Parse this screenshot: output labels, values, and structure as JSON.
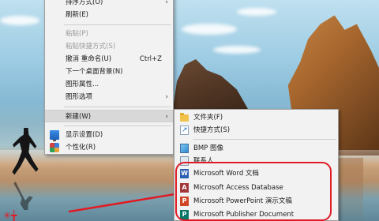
{
  "context_menu": {
    "items": [
      {
        "label": "排序方式(O)",
        "accel": "",
        "submenu": true,
        "disabled": false
      },
      {
        "label": "刷新(E)",
        "accel": "",
        "submenu": false,
        "disabled": false
      },
      {
        "label": "粘贴(P)",
        "accel": "",
        "submenu": false,
        "disabled": true
      },
      {
        "label": "粘贴快捷方式(S)",
        "accel": "",
        "submenu": false,
        "disabled": true
      },
      {
        "label": "撤消 重命名(U)",
        "accel": "Ctrl+Z",
        "submenu": false,
        "disabled": false
      },
      {
        "label": "下一个桌面背景(N)",
        "accel": "",
        "submenu": false,
        "disabled": false
      },
      {
        "label": "图形属性...",
        "accel": "",
        "submenu": false,
        "disabled": false
      },
      {
        "label": "图形选项",
        "accel": "",
        "submenu": true,
        "disabled": false
      },
      {
        "label": "新建(W)",
        "accel": "",
        "submenu": true,
        "disabled": false,
        "highlighted": true
      },
      {
        "label": "显示设置(D)",
        "accel": "",
        "icon": "display-icon"
      },
      {
        "label": "个性化(R)",
        "accel": "",
        "icon": "personalize-icon"
      }
    ]
  },
  "new_submenu": {
    "items": [
      {
        "label": "文件夹(F)",
        "icon": "folder-icon"
      },
      {
        "label": "快捷方式(S)",
        "icon": "shortcut-icon"
      },
      {
        "label": "BMP 图像",
        "icon": "bmp-image-icon"
      },
      {
        "label": "联系人",
        "icon": "contact-icon"
      },
      {
        "label": "Microsoft Word 文档",
        "icon": "word-icon",
        "glyph": "W"
      },
      {
        "label": "Microsoft Access Database",
        "icon": "access-icon",
        "glyph": "A"
      },
      {
        "label": "Microsoft PowerPoint 演示文稿",
        "icon": "powerpoint-icon",
        "glyph": "P"
      },
      {
        "label": "Microsoft Publisher Document",
        "icon": "publisher-icon",
        "glyph": "P"
      }
    ]
  },
  "annotation": {
    "color": "#e01b24"
  }
}
